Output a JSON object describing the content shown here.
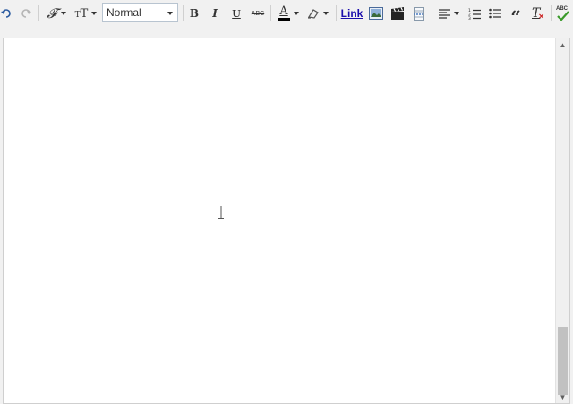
{
  "toolbar": {
    "undo_icon": "undo-icon",
    "redo_icon": "redo-icon",
    "font_family_icon": "font-family-icon",
    "font_size_icon": "font-size-icon",
    "format_select": {
      "value": "Normal"
    },
    "bold_label": "B",
    "italic_label": "I",
    "underline_label": "U",
    "strikethrough_label": "ABC",
    "text_color_label": "A",
    "text_color_bar": "#000000",
    "link_label": "Link",
    "quote_label": "“",
    "remove_format_label": "T",
    "spellcheck_label": "ABC"
  },
  "colors": {
    "toolbar_bg": "#f1f1f1",
    "editor_bg": "#ffffff",
    "link": "#1a0dab",
    "spellcheck_check": "#3a9a2a",
    "remove_format_x": "#cc2222"
  },
  "editor": {
    "content": ""
  }
}
